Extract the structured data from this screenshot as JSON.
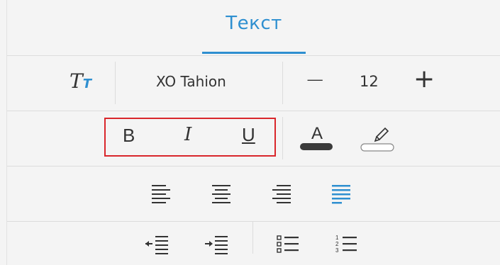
{
  "tab": {
    "title": "Текст"
  },
  "font": {
    "icon_label_big": "T",
    "icon_label_small": "T",
    "name": "XO Tahion",
    "size": "12",
    "minus": "−",
    "plus": "+"
  },
  "format": {
    "bold": "B",
    "italic": "I",
    "underline": "U"
  },
  "colors": {
    "accent": "#2e8fd0",
    "text": "#333333",
    "highlight_box": "#d9262b",
    "color_bar": "#3a3a3a"
  },
  "icons": {
    "text_color": "text-color-icon",
    "highlight": "highlighter-icon",
    "align_left": "align-left-icon",
    "align_center": "align-center-icon",
    "align_right": "align-right-icon",
    "align_justify": "align-justify-icon",
    "indent_decrease": "indent-decrease-icon",
    "indent_increase": "indent-increase-icon",
    "bullet_list": "bullet-list-icon",
    "numbered_list": "numbered-list-icon"
  },
  "text_color_letter": "A",
  "alignment": {
    "selected": "justify"
  }
}
